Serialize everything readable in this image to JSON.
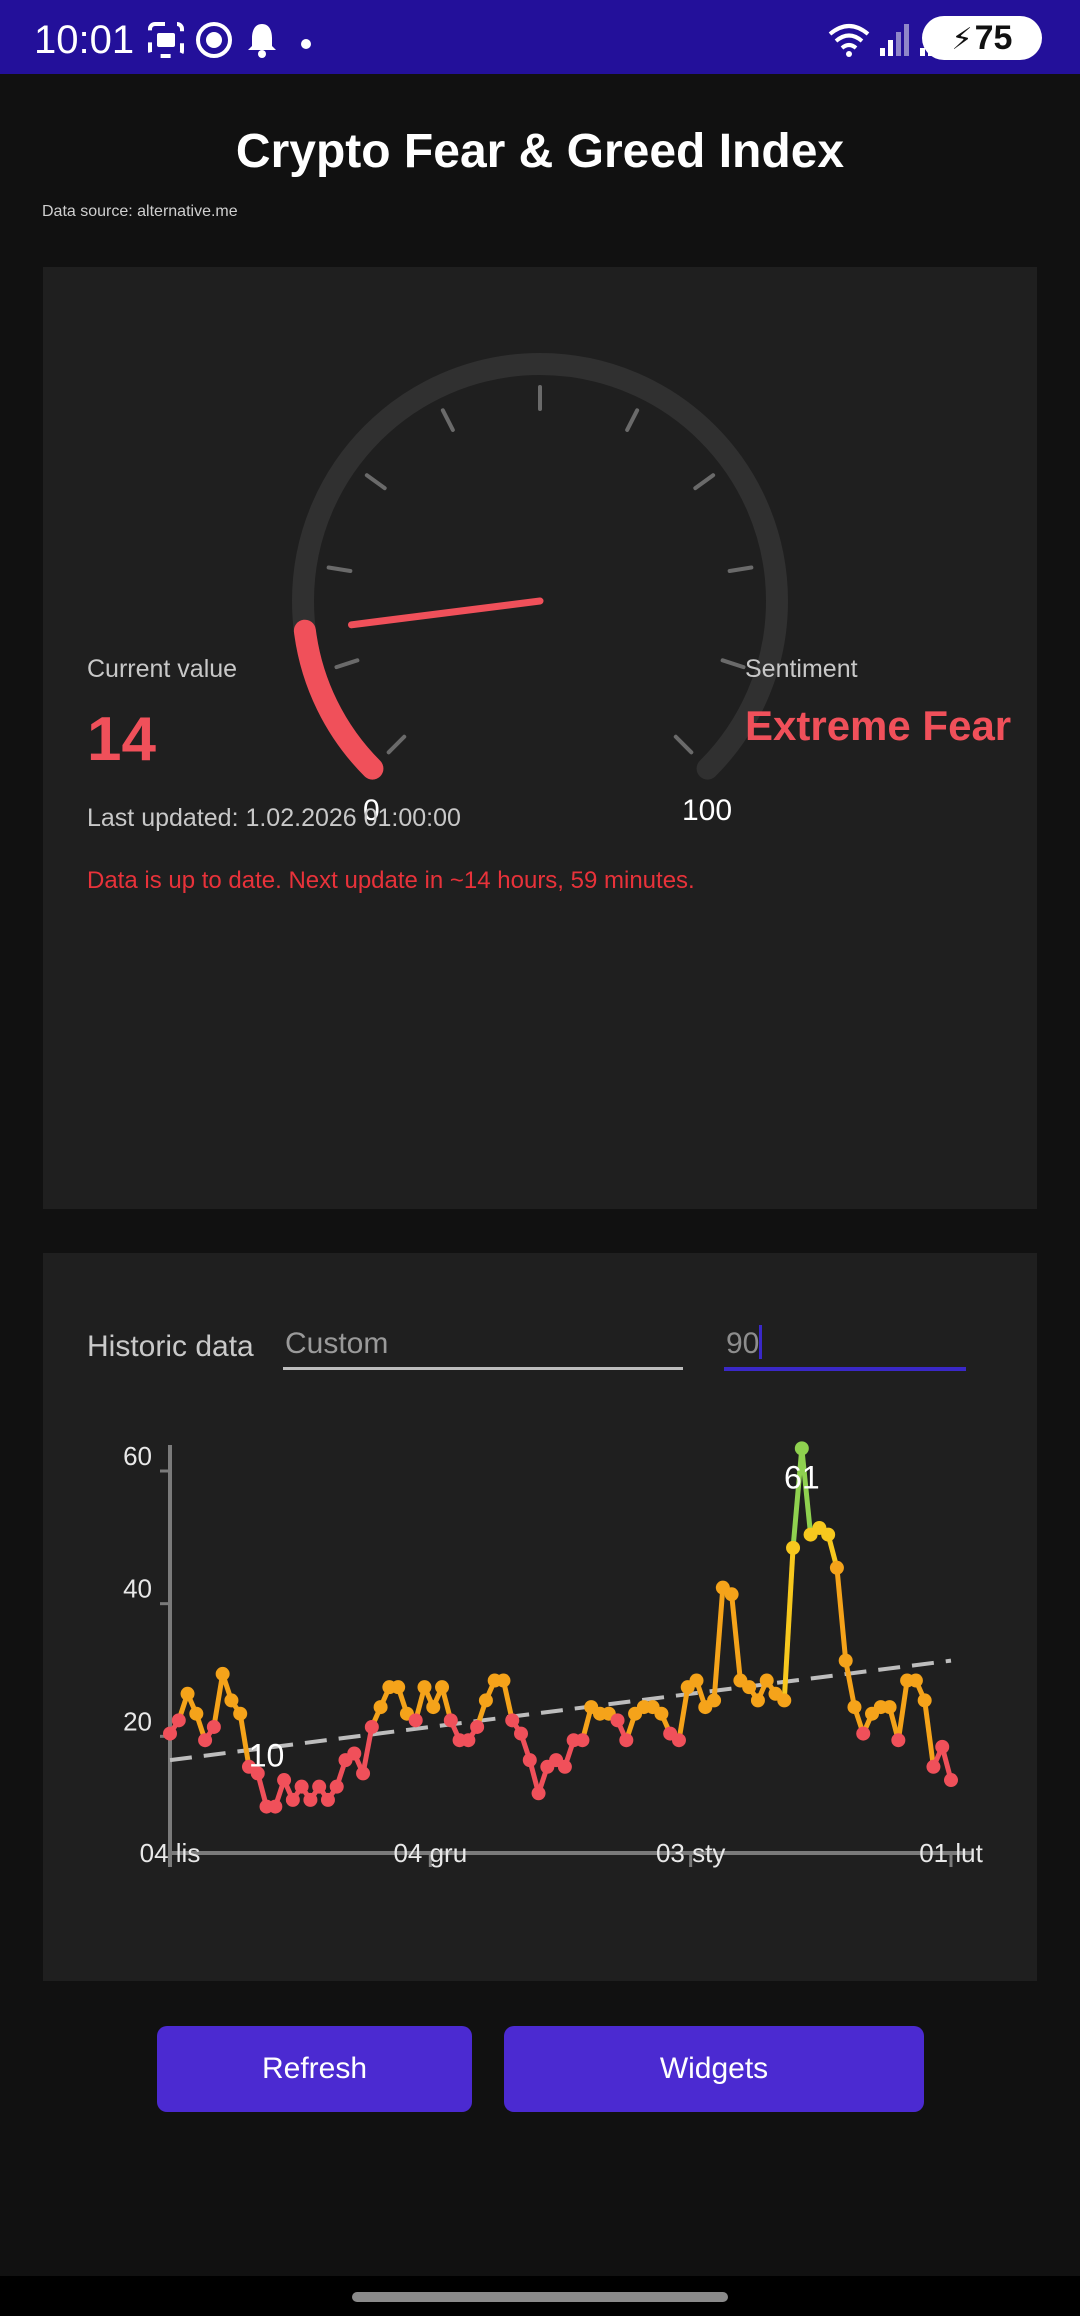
{
  "status_bar": {
    "time": "10:01",
    "battery": "75",
    "icons": [
      "screenshot-icon",
      "vpn-icon",
      "notification-bell-icon",
      "dot-icon",
      "wifi-icon",
      "signal-icon",
      "signal-icon-2",
      "battery-icon"
    ]
  },
  "header": {
    "title": "Crypto Fear & Greed Index",
    "source": "Data source: alternative.me"
  },
  "gauge": {
    "value": 14,
    "min_label": "0",
    "max_label": "100",
    "track_color": "#303030",
    "fill_color": "#f0505a"
  },
  "current": {
    "value_label": "Current value",
    "value": "14",
    "sentiment_label": "Sentiment",
    "sentiment": "Extreme Fear",
    "last_updated": "Last updated: 1.02.2026 01:00:00",
    "status_message": "Data is up to date. Next update in ~14 hours, 59 minutes."
  },
  "history": {
    "label": "Historic data",
    "range_select": "Custom",
    "days_value": "90"
  },
  "chart_data": {
    "type": "line",
    "ylim": [
      0,
      60
    ],
    "y_ticks": [
      "60",
      "40",
      "20"
    ],
    "x_tick_labels": [
      "04 lis",
      "04 gru",
      "03 sty",
      "01 lut"
    ],
    "values": [
      18,
      20,
      24,
      21,
      17,
      19,
      27,
      23,
      21,
      13,
      12,
      7,
      7,
      11,
      8,
      10,
      8,
      10,
      8,
      10,
      14,
      15,
      12,
      19,
      22,
      25,
      25,
      21,
      20,
      25,
      22,
      25,
      20,
      17,
      17,
      19,
      23,
      26,
      26,
      20,
      18,
      14,
      9,
      13,
      14,
      13,
      17,
      17,
      22,
      21,
      21,
      20,
      17,
      21,
      22,
      22,
      21,
      18,
      17,
      25,
      26,
      22,
      23,
      40,
      39,
      26,
      25,
      23,
      26,
      24,
      23,
      46,
      61,
      48,
      49,
      48,
      43,
      29,
      22,
      18,
      21,
      22,
      22,
      17,
      26,
      26,
      23,
      13,
      16,
      11
    ],
    "min_annotation": "10",
    "max_annotation": "61",
    "trend": [
      14,
      29
    ],
    "colors": {
      "extreme_fear": "#f0505a",
      "fear": "#f5a31a",
      "neutral": "#f7c81e",
      "greed": "#8fd14f"
    }
  },
  "buttons": {
    "refresh": "Refresh",
    "widgets": "Widgets"
  }
}
